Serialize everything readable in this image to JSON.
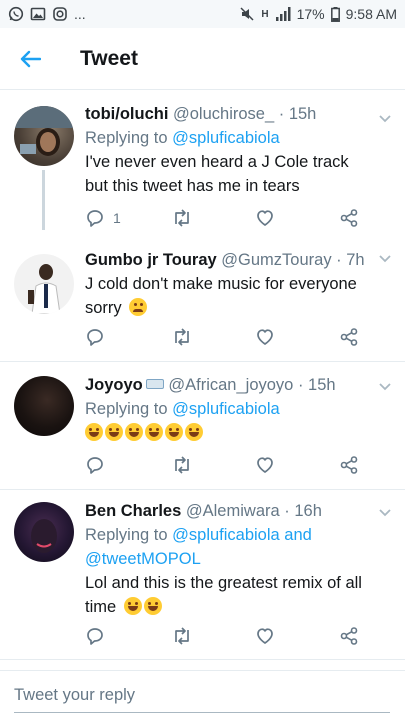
{
  "status_bar": {
    "left_icons": [
      "whatsapp-icon",
      "gallery-icon",
      "instagram-icon"
    ],
    "ellipsis": "...",
    "battery": "17%",
    "time": "9:58 AM",
    "network": "H"
  },
  "header": {
    "title": "Tweet"
  },
  "tweets": [
    {
      "name": "tobi/oluchi",
      "handle": "@oluchirose_",
      "time": "15h",
      "replying_prefix": "Replying to ",
      "replying_to": "@spluficabiola",
      "replying_extra": "",
      "text": "I've never even heard a J Cole track but this tweet has me in tears",
      "reply_count": "1"
    },
    {
      "name": "Gumbo jr Touray",
      "handle": "@GumzTouray",
      "time": "7h",
      "text": "J cold don't make music for everyone sorry"
    },
    {
      "name": "Joyoyo",
      "handle": "@African_joyoyo",
      "time": "15h",
      "replying_prefix": "Replying to ",
      "replying_to": "@spluficabiola"
    },
    {
      "name": "Ben Charles",
      "handle": "@Alemiwara",
      "time": "16h",
      "replying_prefix": "Replying to ",
      "replying_to": "@spluficabiola and",
      "replying_extra": "@tweetMOPOL",
      "text": "Lol and this is the greatest remix of all time"
    }
  ],
  "separator": " · ",
  "reply_box": {
    "placeholder": "Tweet your reply"
  },
  "colors": {
    "accent": "#1da1f2",
    "muted": "#657786",
    "divider": "#e6ecf0"
  }
}
